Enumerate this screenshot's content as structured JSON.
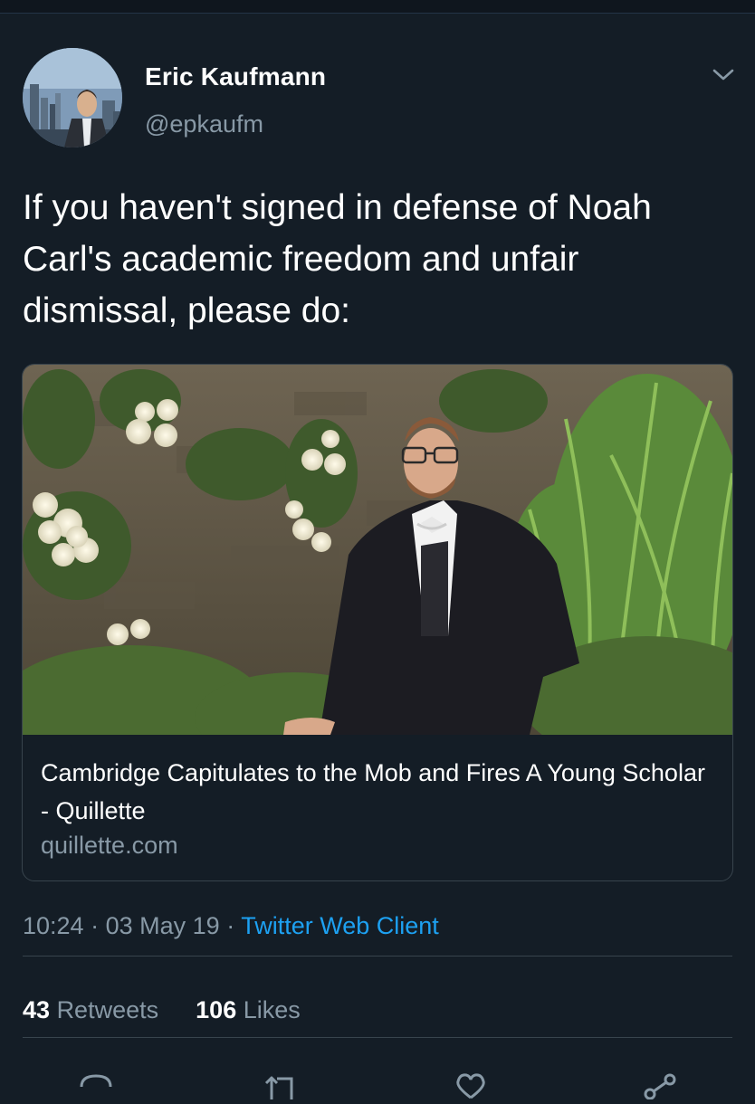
{
  "tweet": {
    "author_name": "Eric Kaufmann",
    "author_handle": "@epkaufm",
    "text": "If you haven't signed in defense of Noah Carl's academic freedom and unfair dismissal, please do:",
    "time": "10:24",
    "date": "03 May 19",
    "separator": "·",
    "source": "Twitter Web Client"
  },
  "card": {
    "title": "Cambridge Capitulates to the Mob and Fires A Young Scholar - Quillette",
    "domain": "quillette.com"
  },
  "stats": {
    "retweets_count": "43",
    "retweets_label": "Retweets",
    "likes_count": "106",
    "likes_label": "Likes"
  },
  "icons": {
    "menu": "chevron-down-icon",
    "reply": "reply-icon",
    "retweet": "retweet-icon",
    "like": "heart-icon",
    "share": "share-icon"
  },
  "colors": {
    "background": "#141d26",
    "text": "#ffffff",
    "secondary": "#8899a6",
    "link": "#1da1f2",
    "border": "#38444d"
  }
}
